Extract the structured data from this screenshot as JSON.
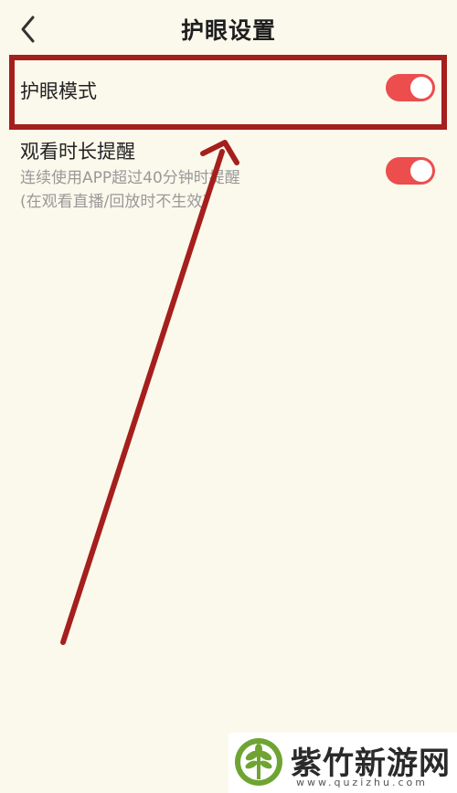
{
  "header": {
    "title": "护眼设置"
  },
  "settings": {
    "eye_mode": {
      "label": "护眼模式",
      "enabled": true
    },
    "watch_reminder": {
      "label": "观看时长提醒",
      "desc_line1": "连续使用APP超过40分钟时提醒",
      "desc_line2": "(在观看直播/回放时不生效)",
      "enabled": true
    }
  },
  "colors": {
    "background": "#fbf8ec",
    "toggle_on": "#ec4d4d",
    "annotation": "#a51f1d"
  },
  "watermark": {
    "name": "紫竹新游网",
    "url": "www.quzizhu.com"
  }
}
